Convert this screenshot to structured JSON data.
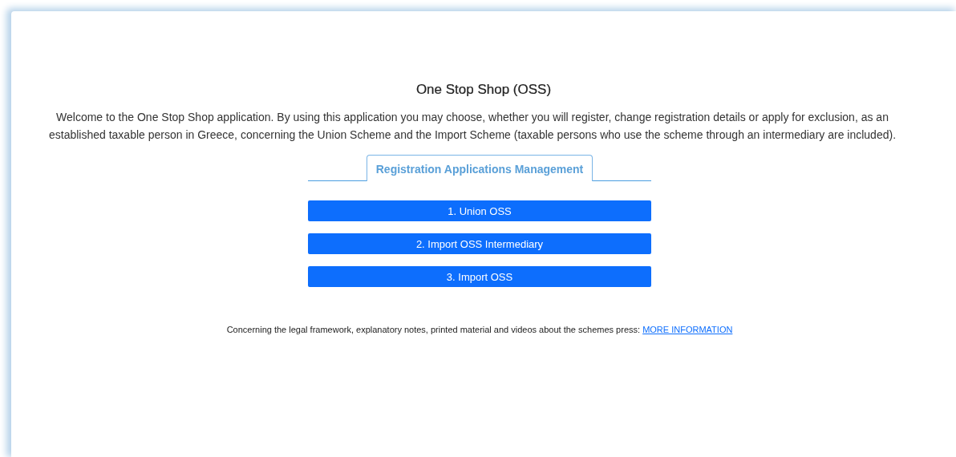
{
  "title": "One Stop Shop (OSS)",
  "intro": "Welcome to the One Stop Shop application. By using this application you may choose, whether you will register, change registration details or apply for exclusion, as an established taxable person in Greece, concerning the Union Scheme and the Import Scheme (taxable persons who use the scheme through an intermediary are included).",
  "tabs": [
    {
      "label": "Registration Applications Management",
      "selected": true
    }
  ],
  "buttons": [
    "1. Union OSS",
    "2. Import OSS Intermediary",
    "3. Import OSS"
  ],
  "info": {
    "text": "Concerning the legal framework, explanatory notes, printed material and videos about the schemes press: ",
    "link": "MORE INFORMATION"
  }
}
